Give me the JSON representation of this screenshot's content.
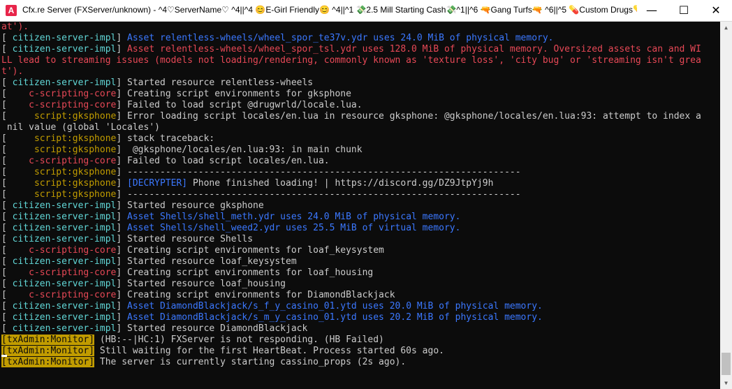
{
  "window": {
    "app_icon_glyph": "A",
    "title": "Cfx.re Server (FXServer/unknown) - ^4♡ServerName♡ ^4||^4 😊E-Girl Friendly😊 ^4||^1 💸2.5 Mill Starting Cash💸^1||^6 🔫Gang Turfs🔫 ^6||^5 💊Custom Drugs💊 ...",
    "minimize_glyph": "—",
    "maximize_glyph": "☐",
    "close_glyph": "✕"
  },
  "console": {
    "lines": [
      {
        "tag": "",
        "tag_color": "",
        "text": "at').",
        "text_color": "red",
        "is_cont": true
      },
      {
        "tag": " citizen-server-impl",
        "tag_color": "teal",
        "text": " Asset relentless-wheels/wheel_spor_te37v.ydr uses 24.0 MiB of physical memory.",
        "text_color": "blue"
      },
      {
        "tag": " citizen-server-impl",
        "tag_color": "teal",
        "text": " Asset relentless-wheels/wheel_spor_tsl.ydr uses 128.0 MiB of physical memory. Oversized assets can and WI",
        "text_color": "redtext"
      },
      {
        "tag": "",
        "tag_color": "",
        "text": "LL lead to streaming issues (models not loading/rendering, commonly known as 'texture loss', 'city bug' or 'streaming isn't grea",
        "text_color": "redtext",
        "is_cont": true
      },
      {
        "tag": "",
        "tag_color": "",
        "text": "t').",
        "text_color": "redtext",
        "is_cont": true
      },
      {
        "tag": " citizen-server-impl",
        "tag_color": "teal",
        "text": " Started resource relentless-wheels",
        "text_color": "white"
      },
      {
        "tag": "    c-scripting-core",
        "tag_color": "red",
        "text": " Creating script environments for gksphone",
        "text_color": "white"
      },
      {
        "tag": "    c-scripting-core",
        "tag_color": "red",
        "text": " Failed to load script @drugwrld/locale.lua.",
        "text_color": "white"
      },
      {
        "tag": "     script:gksphone",
        "tag_color": "gold",
        "text": " Error loading script locales/en.lua in resource gksphone: @gksphone/locales/en.lua:93: attempt to index a",
        "text_color": "white"
      },
      {
        "tag": "",
        "tag_color": "",
        "text": " nil value (global 'Locales')",
        "text_color": "white",
        "is_cont": true
      },
      {
        "tag": "     script:gksphone",
        "tag_color": "gold",
        "text": " stack traceback:",
        "text_color": "white"
      },
      {
        "tag": "     script:gksphone",
        "tag_color": "gold",
        "text": "  @gksphone/locales/en.lua:93: in main chunk",
        "text_color": "white"
      },
      {
        "tag": "    c-scripting-core",
        "tag_color": "red",
        "text": " Failed to load script locales/en.lua.",
        "text_color": "white"
      },
      {
        "tag": "     script:gksphone",
        "tag_color": "gold",
        "text": " ------------------------------------------------------------------------",
        "text_color": "white"
      },
      {
        "tag": "     script:gksphone",
        "tag_color": "gold",
        "text": " [DECRYPTER] Phone finished loading! | https://discord.gg/DZ9JtpYj9h",
        "text_color": "white",
        "dec": true
      },
      {
        "tag": "     script:gksphone",
        "tag_color": "gold",
        "text": " ------------------------------------------------------------------------",
        "text_color": "white"
      },
      {
        "tag": " citizen-server-impl",
        "tag_color": "teal",
        "text": " Started resource gksphone",
        "text_color": "white"
      },
      {
        "tag": " citizen-server-impl",
        "tag_color": "teal",
        "text": " Asset Shells/shell_meth.ydr uses 24.0 MiB of physical memory.",
        "text_color": "blue"
      },
      {
        "tag": " citizen-server-impl",
        "tag_color": "teal",
        "text": " Asset Shells/shell_weed2.ydr uses 25.5 MiB of virtual memory.",
        "text_color": "blue"
      },
      {
        "tag": " citizen-server-impl",
        "tag_color": "teal",
        "text": " Started resource Shells",
        "text_color": "white"
      },
      {
        "tag": "    c-scripting-core",
        "tag_color": "red",
        "text": " Creating script environments for loaf_keysystem",
        "text_color": "white"
      },
      {
        "tag": " citizen-server-impl",
        "tag_color": "teal",
        "text": " Started resource loaf_keysystem",
        "text_color": "white"
      },
      {
        "tag": "    c-scripting-core",
        "tag_color": "red",
        "text": " Creating script environments for loaf_housing",
        "text_color": "white"
      },
      {
        "tag": " citizen-server-impl",
        "tag_color": "teal",
        "text": " Started resource loaf_housing",
        "text_color": "white"
      },
      {
        "tag": "    c-scripting-core",
        "tag_color": "red",
        "text": " Creating script environments for DiamondBlackjack",
        "text_color": "white"
      },
      {
        "tag": " citizen-server-impl",
        "tag_color": "teal",
        "text": " Asset DiamondBlackjack/s_f_y_casino_01.ytd uses 20.0 MiB of physical memory.",
        "text_color": "blue"
      },
      {
        "tag": " citizen-server-impl",
        "tag_color": "teal",
        "text": " Asset DiamondBlackjack/s_m_y_casino_01.ytd uses 20.2 MiB of physical memory.",
        "text_color": "blue"
      },
      {
        "tag": " citizen-server-impl",
        "tag_color": "teal",
        "text": " Started resource DiamondBlackjack",
        "text_color": "white"
      },
      {
        "tag": "txAdmin:Monitor",
        "tag_color": "tx",
        "text": " (HB:--|HC:1) FXServer is not responding. (HB Failed)",
        "text_color": "white"
      },
      {
        "tag": "txAdmin:Monitor",
        "tag_color": "tx",
        "text": " Still waiting for the first HeartBeat. Process started 60s ago.",
        "text_color": "white"
      },
      {
        "tag": "txAdmin:Monitor",
        "tag_color": "tx",
        "text": " The server is currently starting cassino_props (2s ago).",
        "text_color": "white"
      }
    ]
  },
  "scrollbar": {
    "up_glyph": "▲",
    "down_glyph": "▼"
  }
}
